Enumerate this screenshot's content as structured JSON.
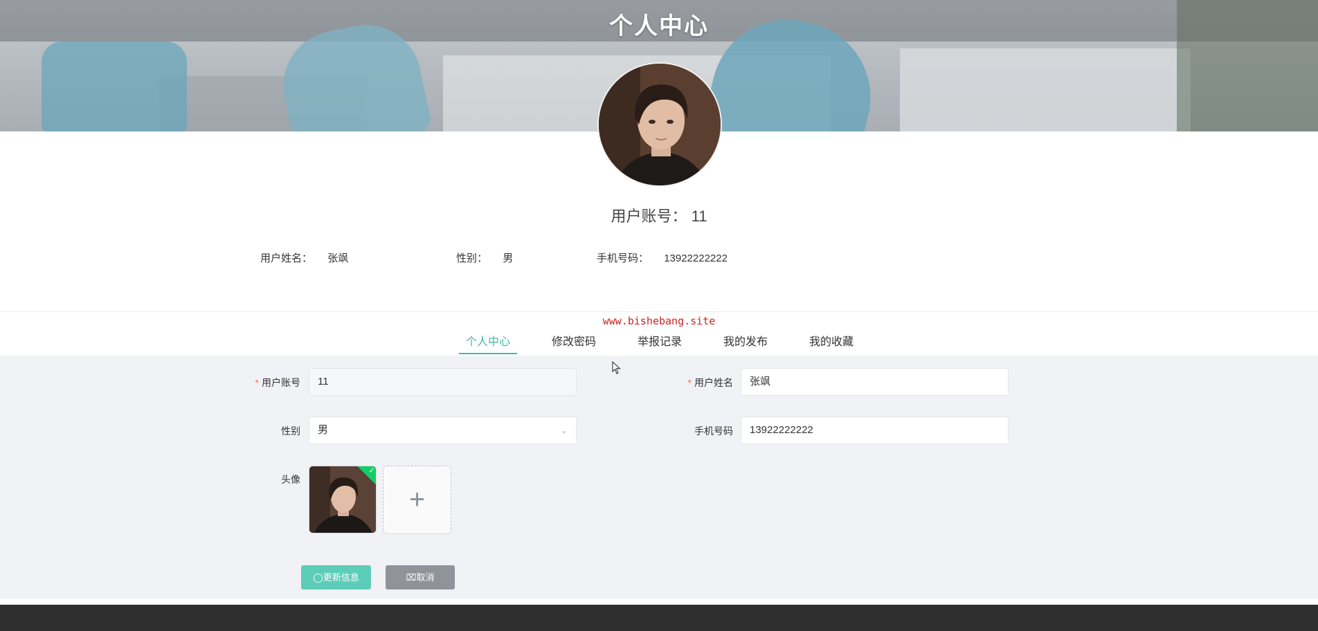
{
  "banner": {
    "title": "个人中心"
  },
  "profile": {
    "account_label": "用户账号：",
    "account_value": "11",
    "name_label": "用户姓名：",
    "name_value": "张飒",
    "gender_label": "性别：",
    "gender_value": "男",
    "phone_label": "手机号码：",
    "phone_value": "13922222222"
  },
  "watermark": "www.bishebang.site",
  "tabs": [
    {
      "label": "个人中心",
      "active": true
    },
    {
      "label": "修改密码",
      "active": false
    },
    {
      "label": "举报记录",
      "active": false
    },
    {
      "label": "我的发布",
      "active": false
    },
    {
      "label": "我的收藏",
      "active": false
    }
  ],
  "form": {
    "account": {
      "label": "用户账号",
      "value": "11",
      "required": true,
      "disabled": true
    },
    "name": {
      "label": "用户姓名",
      "value": "张飒",
      "required": true
    },
    "gender": {
      "label": "性别",
      "value": "男"
    },
    "phone": {
      "label": "手机号码",
      "value": "13922222222"
    },
    "avatar": {
      "label": "头像"
    }
  },
  "buttons": {
    "update_label": "更新信息",
    "cancel_label": "取消"
  },
  "colors": {
    "accent": "#3fb8a9",
    "primary_button": "#5ccdb8",
    "cancel_button": "#909399",
    "watermark": "#cc2222",
    "footer": "#2f2f2f"
  }
}
